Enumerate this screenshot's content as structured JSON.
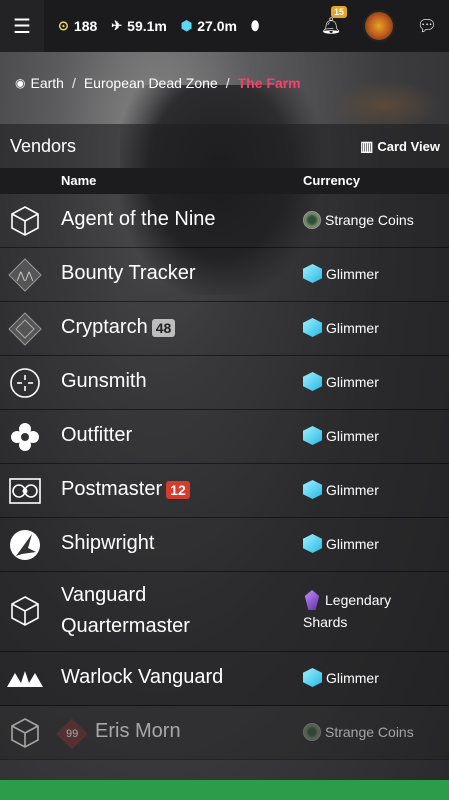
{
  "topbar": {
    "menu_icon": "hamburger-icon",
    "stats": [
      {
        "icon": "silver-coin-icon",
        "value": "188"
      },
      {
        "icon": "bright-dust-icon",
        "value": "59.1m"
      },
      {
        "icon": "glimmer-icon",
        "value": "27.0m"
      }
    ],
    "notification_count": "15"
  },
  "breadcrumb": {
    "items": [
      "Earth",
      "European Dead Zone"
    ],
    "current": "The Farm"
  },
  "vendors": {
    "title": "Vendors",
    "card_view_label": "Card View",
    "col_name": "Name",
    "col_currency": "Currency",
    "rows": [
      {
        "name": "Agent of the Nine",
        "currency": "Strange Coins",
        "currency_icon": "strange-coin-icon"
      },
      {
        "name": "Bounty Tracker",
        "currency": "Glimmer",
        "currency_icon": "glimmer-icon"
      },
      {
        "name": "Cryptarch",
        "badge": "48",
        "currency": "Glimmer",
        "currency_icon": "glimmer-icon"
      },
      {
        "name": "Gunsmith",
        "currency": "Glimmer",
        "currency_icon": "glimmer-icon"
      },
      {
        "name": "Outfitter",
        "currency": "Glimmer",
        "currency_icon": "glimmer-icon"
      },
      {
        "name": "Postmaster",
        "badge": "12",
        "currency": "Glimmer",
        "currency_icon": "glimmer-icon"
      },
      {
        "name": "Shipwright",
        "currency": "Glimmer",
        "currency_icon": "glimmer-icon"
      },
      {
        "name_line1": "Vanguard",
        "name_line2": "Quartermaster",
        "currency_line1": "Legendary",
        "currency_line2": "Shards",
        "currency_icon": "legendary-shards-icon"
      },
      {
        "name": "Warlock Vanguard",
        "currency": "Glimmer",
        "currency_icon": "glimmer-icon"
      },
      {
        "name": "Eris Morn",
        "rank": "99",
        "currency": "Strange Coins",
        "currency_icon": "strange-coin-icon"
      }
    ]
  },
  "colors": {
    "accent": "#ff3d6a",
    "badge_red": "#d63b2c",
    "notify": "#e8a226",
    "bottom_bar": "#2c9b4a"
  }
}
